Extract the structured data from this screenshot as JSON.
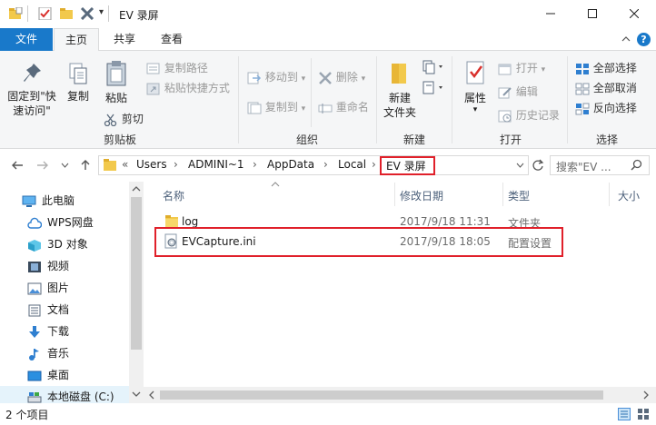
{
  "window": {
    "title": "EV 录屏",
    "qat_dropdown_glyph": "▾"
  },
  "tabs": [
    "文件",
    "主页",
    "共享",
    "查看"
  ],
  "ribbon": {
    "clipboard": {
      "pin_line1": "固定到\"快",
      "pin_line2": "速访问\"",
      "copy": "复制",
      "paste": "粘贴",
      "copy_path": "复制路径",
      "paste_shortcut": "粘贴快捷方式",
      "cut": "剪切",
      "label": "剪贴板"
    },
    "organize": {
      "move_to": "移动到",
      "copy_to": "复制到",
      "delete": "删除",
      "rename": "重命名",
      "label": "组织"
    },
    "new": {
      "new_folder_line1": "新建",
      "new_folder_line2": "文件夹",
      "label": "新建"
    },
    "open": {
      "properties": "属性",
      "open": "打开",
      "edit": "编辑",
      "history": "历史记录",
      "label": "打开"
    },
    "select": {
      "select_all": "全部选择",
      "select_none": "全部取消",
      "invert": "反向选择",
      "label": "选择"
    }
  },
  "address": {
    "prefix": "«",
    "crumbs": [
      "Users",
      "ADMINI~1",
      "AppData",
      "Local",
      "EV 录屏"
    ],
    "search_placeholder": "搜索\"EV ...",
    "highlight_color": "#e0202a"
  },
  "nav": [
    {
      "label": "此电脑",
      "icon": "computer-icon"
    },
    {
      "label": "WPS网盘",
      "icon": "cloud-icon"
    },
    {
      "label": "3D 对象",
      "icon": "cube-icon"
    },
    {
      "label": "视频",
      "icon": "video-icon"
    },
    {
      "label": "图片",
      "icon": "picture-icon"
    },
    {
      "label": "文档",
      "icon": "document-icon"
    },
    {
      "label": "下载",
      "icon": "download-icon"
    },
    {
      "label": "音乐",
      "icon": "music-icon"
    },
    {
      "label": "桌面",
      "icon": "desktop-icon"
    },
    {
      "label": "本地磁盘 (C:)",
      "icon": "drive-icon"
    }
  ],
  "columns": [
    "名称",
    "修改日期",
    "类型",
    "大小"
  ],
  "files": [
    {
      "name": "log",
      "date": "2017/9/18 11:31",
      "type": "文件夹",
      "icon": "folder-icon"
    },
    {
      "name": "EVCapture.ini",
      "date": "2017/9/18 18:05",
      "type": "配置设置",
      "icon": "ini-file-icon"
    }
  ],
  "status": {
    "count": "2 个项目"
  }
}
